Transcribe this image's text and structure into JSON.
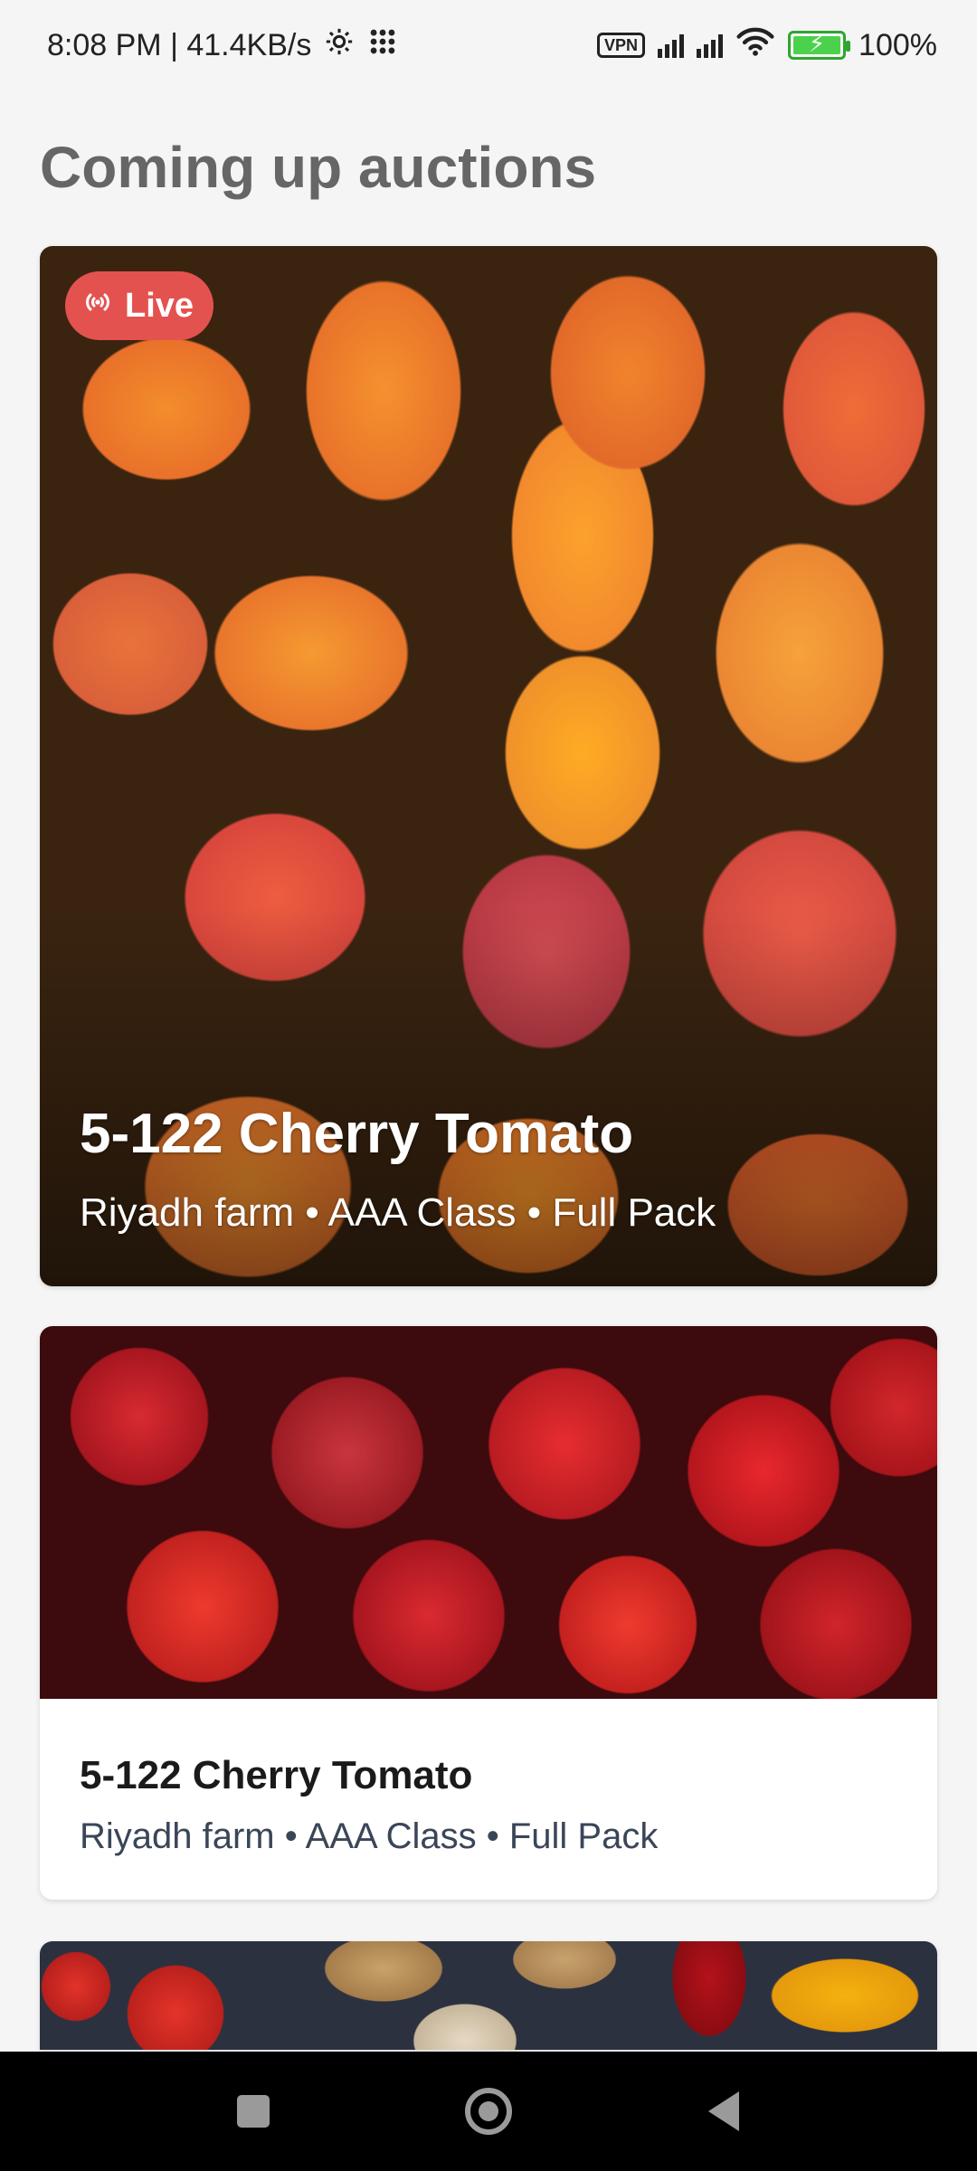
{
  "status_bar": {
    "time_speed": "8:08 PM | 41.4KB/s",
    "vpn": "VPN",
    "battery": "100%",
    "battery_level": 1.0
  },
  "page": {
    "title": "Coming up auctions"
  },
  "auctions": [
    {
      "badge": "Live",
      "title": "5-122 Cherry Tomato",
      "subtitle": "Riyadh farm • AAA Class • Full Pack",
      "image": "mangoes-photo"
    },
    {
      "title": "5-122 Cherry Tomato",
      "subtitle": "Riyadh farm • AAA Class • Full Pack",
      "image": "apples-photo"
    },
    {
      "image": "vegetables-photo"
    }
  ],
  "icons": {
    "live": "broadcast-icon",
    "settings": "gear-icon",
    "apps": "dots-grid-icon",
    "signal": "signal-icon",
    "wifi": "wifi-icon",
    "battery": "battery-charging-icon",
    "nav_recent": "square-icon",
    "nav_home": "circle-icon",
    "nav_back": "triangle-back-icon"
  },
  "colors": {
    "live_badge": "#e4524f",
    "background": "#f5f5f5",
    "title": "#666666",
    "battery": "#4cd14c"
  }
}
